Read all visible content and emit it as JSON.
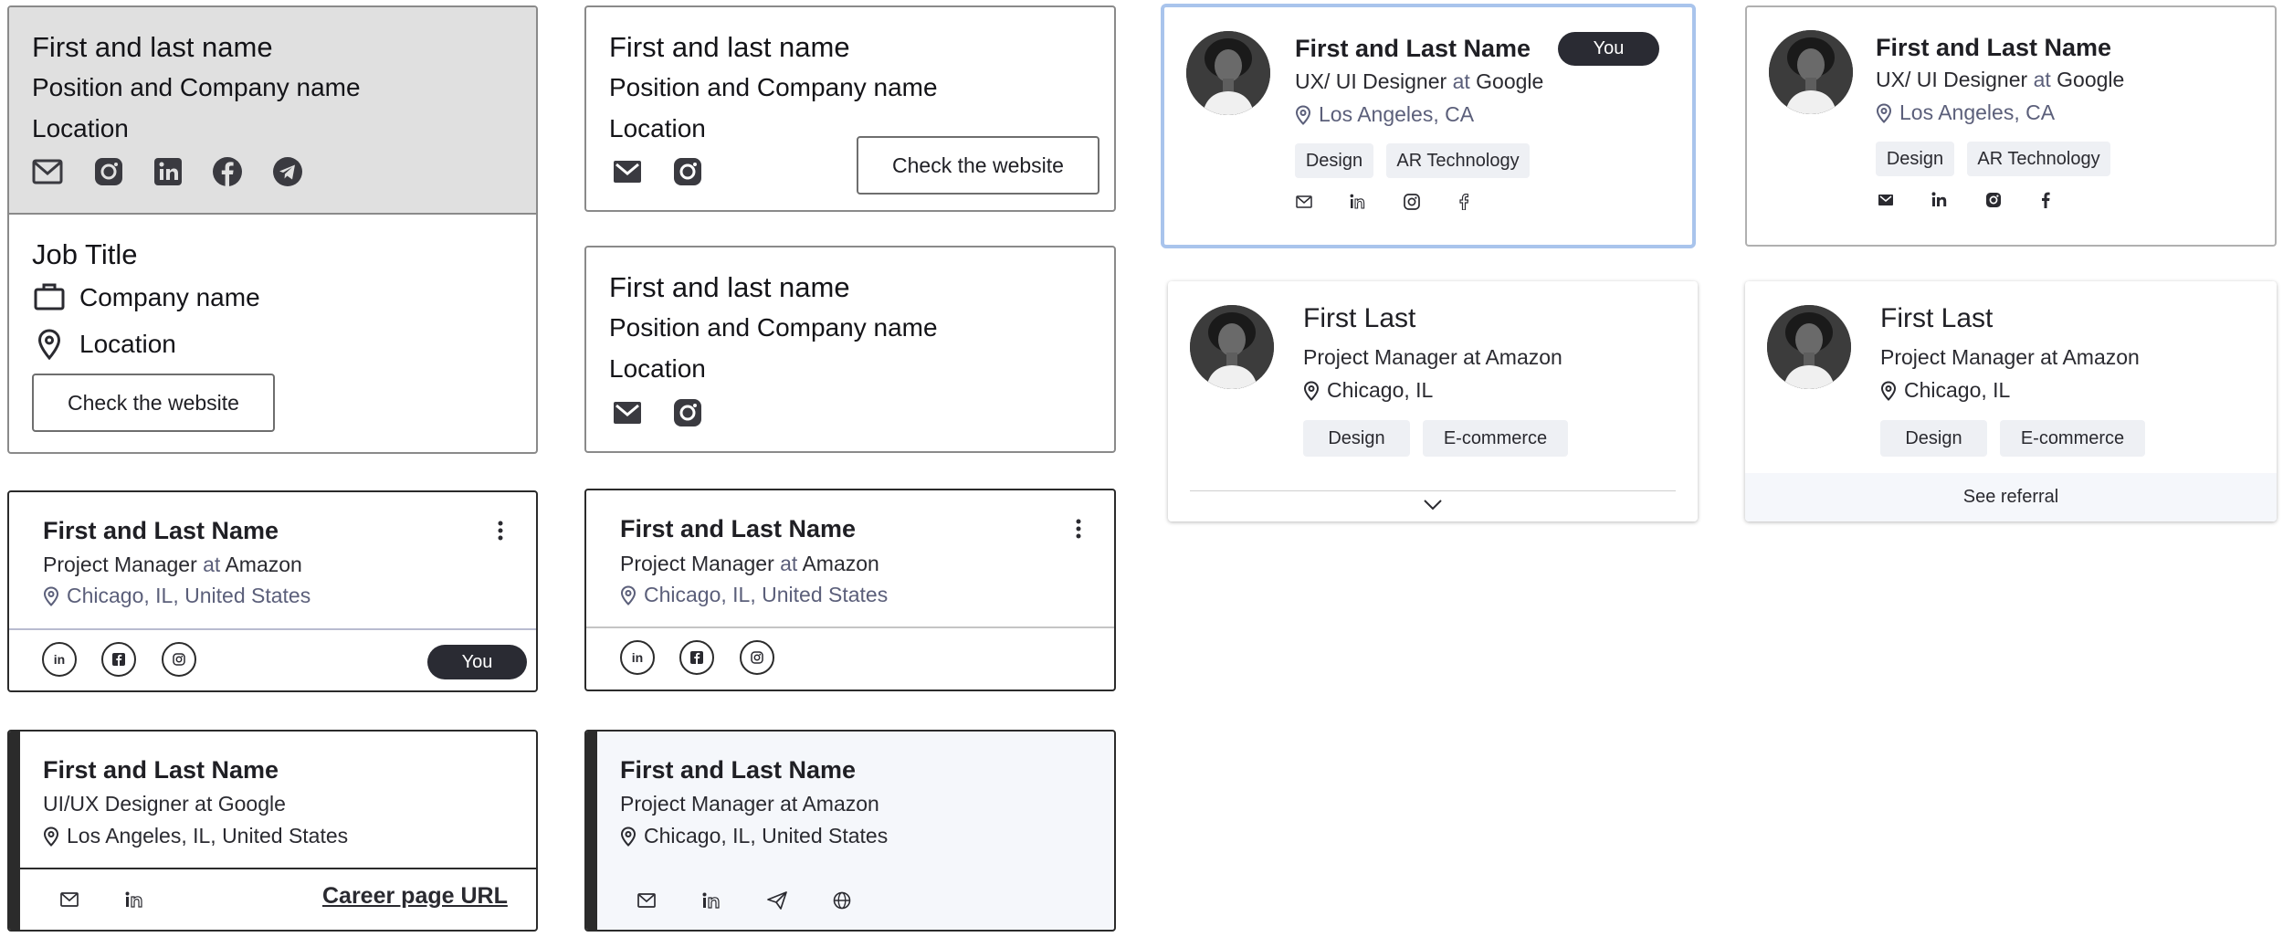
{
  "card1": {
    "top": {
      "name": "First and last name",
      "position": "Position and Company name",
      "location": "Location",
      "icons": [
        "mail-icon",
        "instagram-icon",
        "linkedin-icon",
        "facebook-icon",
        "telegram-icon"
      ]
    },
    "bottom": {
      "job_title": "Job Title",
      "company": "Company name",
      "location": "Location",
      "button": "Check the website"
    }
  },
  "card2": {
    "name": "First and last name",
    "position": "Position and Company name",
    "location": "Location",
    "button": "Check the website"
  },
  "card3": {
    "name": "First and last name",
    "position": "Position and Company name",
    "location": "Location"
  },
  "card4": {
    "name": "First and Last Name",
    "role": "Project Manager",
    "at": "at",
    "company": "Amazon",
    "location": "Chicago, IL, United States",
    "badge": "You"
  },
  "card5": {
    "name": "First and Last Name",
    "role": "Project Manager",
    "at": "at",
    "company": "Amazon",
    "location": "Chicago, IL, United States"
  },
  "card6": {
    "name": "First and Last Name",
    "role": "UI/UX Designer at Google",
    "location": "Los Angeles, IL, United States",
    "link": "Career page URL"
  },
  "card7": {
    "name": "First and Last Name",
    "role": "Project Manager at Amazon",
    "location": "Chicago, IL, United States"
  },
  "card8": {
    "name": "First and Last Name",
    "role": "UX/ UI Designer",
    "at": "at",
    "company": "Google",
    "location": "Los Angeles, CA",
    "badge": "You",
    "tags": [
      "Design",
      "AR Technology"
    ]
  },
  "card9": {
    "name": "First and Last Name",
    "role": "UX/ UI Designer",
    "at": "at",
    "company": "Google",
    "location": "Los Angeles, CA",
    "tags": [
      "Design",
      "AR Technology"
    ]
  },
  "card10": {
    "name": "First Last",
    "role": "Project Manager at Amazon",
    "location": "Chicago, IL",
    "tags": [
      "Design",
      "E-commerce"
    ]
  },
  "card11": {
    "name": "First Last",
    "role": "Project Manager at Amazon",
    "location": "Chicago, IL",
    "tags": [
      "Design",
      "E-commerce"
    ],
    "footer": "See referral"
  },
  "colors": {
    "selected_border": "#a9c4ec",
    "pill": "#2a2b33",
    "tag_bg": "#eef0f4",
    "muted_text": "#5b5f7a",
    "accent_bar": "#2b2b2b",
    "tinted_bg": "#f5f7fb"
  }
}
